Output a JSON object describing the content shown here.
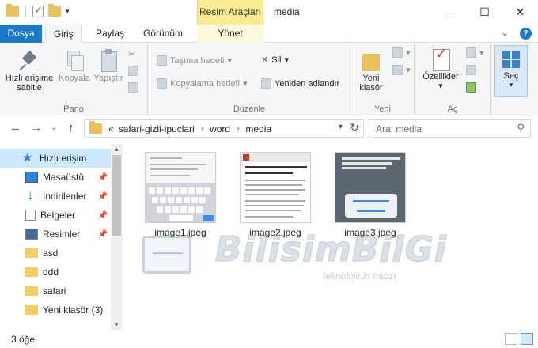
{
  "window": {
    "title": "media",
    "context_tab_header": "Resim Araçları",
    "controls": {
      "minimize": "—",
      "maximize": "☐",
      "close": "✕"
    }
  },
  "tabs": [
    {
      "label": "Dosya"
    },
    {
      "label": "Giriş"
    },
    {
      "label": "Paylaş"
    },
    {
      "label": "Görünüm"
    },
    {
      "label": "Yönet"
    }
  ],
  "ribbon": {
    "pano": {
      "label": "Pano",
      "pin": "Hızlı erişime sabitle",
      "copy": "Kopyala",
      "paste": "Yapıştır"
    },
    "duzenle": {
      "label": "Düzenle",
      "move_to": "Taşıma hedefi",
      "copy_to": "Kopyalama hedefi",
      "delete": "Sil",
      "rename": "Yeniden adlandır"
    },
    "yeni": {
      "label": "Yeni",
      "new_folder": "Yeni klasör"
    },
    "ac": {
      "label": "Aç",
      "properties": "Özellikler"
    },
    "sec": {
      "label": "Seç"
    }
  },
  "address": {
    "overflow": "«",
    "crumbs": [
      "safari-gizli-ipuclari",
      "word",
      "media"
    ],
    "search_placeholder": "Ara: media"
  },
  "nav": {
    "items": [
      {
        "label": "Hızlı erişim",
        "icon": "star-icon",
        "pinned": false,
        "selected": true
      },
      {
        "label": "Masaüstü",
        "icon": "desktop-icon",
        "pinned": true
      },
      {
        "label": "İndirilenler",
        "icon": "download-icon",
        "pinned": true
      },
      {
        "label": "Belgeler",
        "icon": "documents-icon",
        "pinned": true
      },
      {
        "label": "Resimler",
        "icon": "pictures-icon",
        "pinned": true
      },
      {
        "label": "asd",
        "icon": "folder-icon",
        "pinned": false
      },
      {
        "label": "ddd",
        "icon": "folder-icon",
        "pinned": false
      },
      {
        "label": "safari",
        "icon": "folder-icon",
        "pinned": false
      },
      {
        "label": "Yeni klasör (3)",
        "icon": "folder-icon",
        "pinned": false
      }
    ]
  },
  "files": [
    {
      "name": "image1.jpeg"
    },
    {
      "name": "image2.jpeg"
    },
    {
      "name": "image3.jpeg"
    }
  ],
  "watermark": {
    "brand": "BilisimBilGi",
    "tagline": "teknolojinin nabzı"
  },
  "status": {
    "count": "3 öğe"
  }
}
